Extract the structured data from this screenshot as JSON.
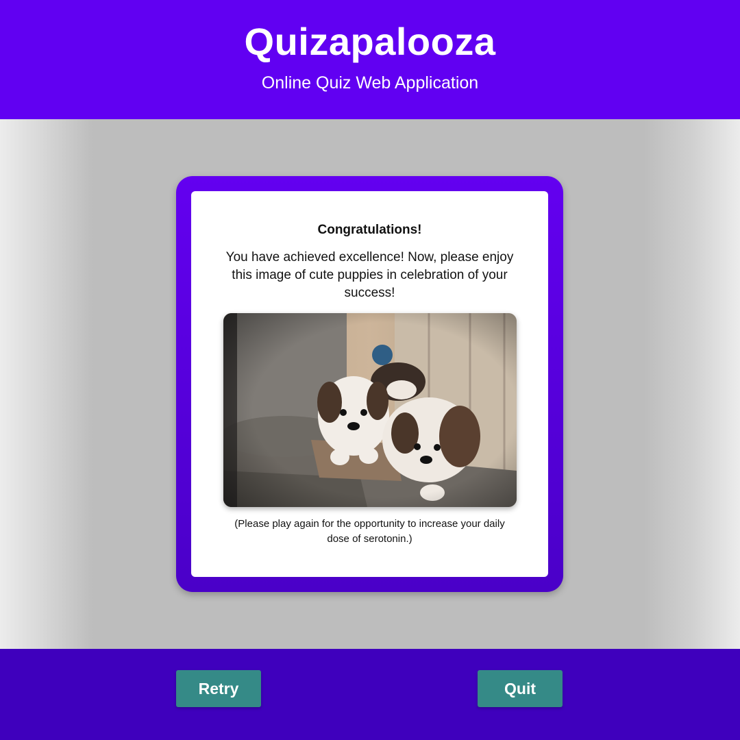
{
  "header": {
    "title": "Quizapalooza",
    "subtitle": "Online Quiz Web Application"
  },
  "result": {
    "heading": "Congratulations!",
    "message": "You have achieved excellence! Now, please enjoy this image of cute puppies in celebration of your success!",
    "image_subject": "puppies-photo",
    "footnote": "(Please play again for the opportunity to increase your daily dose of serotonin.)"
  },
  "footer": {
    "retry_label": "Retry",
    "quit_label": "Quit"
  },
  "colors": {
    "header_bg": "#6100f2",
    "footer_bg": "#3f00bd",
    "button_bg": "#358a87",
    "card_frame": "#6300f0"
  }
}
